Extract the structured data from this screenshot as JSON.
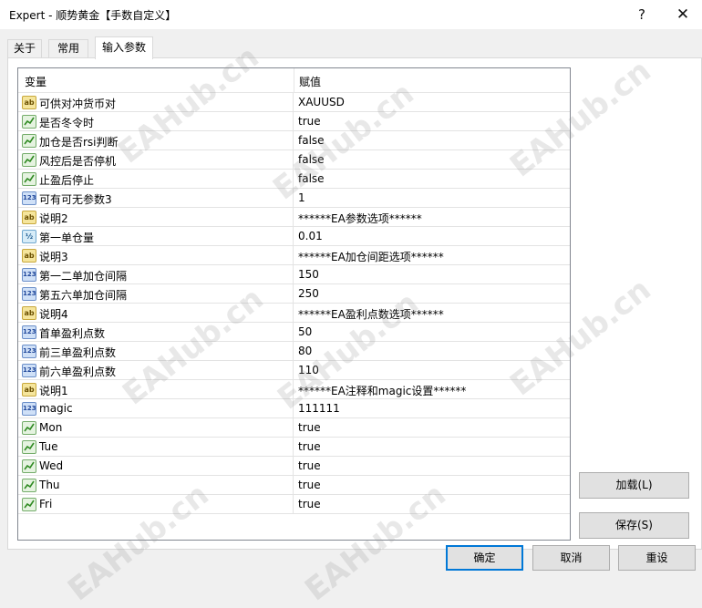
{
  "window": {
    "title": "Expert - 顺势黄金【手数自定义】",
    "help_glyph": "?",
    "close_glyph": "✕"
  },
  "tabs": [
    {
      "label": "关于",
      "active": false
    },
    {
      "label": "常用",
      "active": false
    },
    {
      "label": "输入参数",
      "active": true
    }
  ],
  "grid": {
    "col_variable": "变量",
    "col_value": "赋值",
    "rows": [
      {
        "icon": "ab",
        "name": "可供对冲货币对",
        "value": "XAUUSD"
      },
      {
        "icon": "bool",
        "name": "是否冬令时",
        "value": "true"
      },
      {
        "icon": "bool",
        "name": "加仓是否rsi判断",
        "value": "false"
      },
      {
        "icon": "bool",
        "name": "风控后是否停机",
        "value": "false"
      },
      {
        "icon": "bool",
        "name": "止盈后停止",
        "value": "false"
      },
      {
        "icon": "num",
        "name": "可有可无参数3",
        "value": "1"
      },
      {
        "icon": "ab",
        "name": "说明2",
        "value": "******EA参数选项******"
      },
      {
        "icon": "half",
        "name": "第一单仓量",
        "value": "0.01"
      },
      {
        "icon": "ab",
        "name": "说明3",
        "value": "******EA加仓间距选项******"
      },
      {
        "icon": "num",
        "name": "第一二单加仓间隔",
        "value": "150"
      },
      {
        "icon": "num",
        "name": "第五六单加仓间隔",
        "value": "250"
      },
      {
        "icon": "ab",
        "name": "说明4",
        "value": "******EA盈利点数选项******"
      },
      {
        "icon": "num",
        "name": "首单盈利点数",
        "value": "50"
      },
      {
        "icon": "num",
        "name": "前三单盈利点数",
        "value": "80"
      },
      {
        "icon": "num",
        "name": "前六单盈利点数",
        "value": "110"
      },
      {
        "icon": "ab",
        "name": "说明1",
        "value": "******EA注释和magic设置******"
      },
      {
        "icon": "num",
        "name": "magic",
        "value": "111111"
      },
      {
        "icon": "bool",
        "name": "Mon",
        "value": "true"
      },
      {
        "icon": "bool",
        "name": "Tue",
        "value": "true"
      },
      {
        "icon": "bool",
        "name": "Wed",
        "value": "true"
      },
      {
        "icon": "bool",
        "name": "Thu",
        "value": "true"
      },
      {
        "icon": "bool",
        "name": "Fri",
        "value": "true"
      }
    ]
  },
  "icon_glyphs": {
    "ab": "ab",
    "num": "123",
    "half": "½"
  },
  "buttons": {
    "load": "加载(L)",
    "save": "保存(S)",
    "ok": "确定",
    "cancel": "取消",
    "reset": "重设"
  },
  "watermark": "EAHub.cn",
  "colors": {
    "accent": "#0078d7"
  }
}
